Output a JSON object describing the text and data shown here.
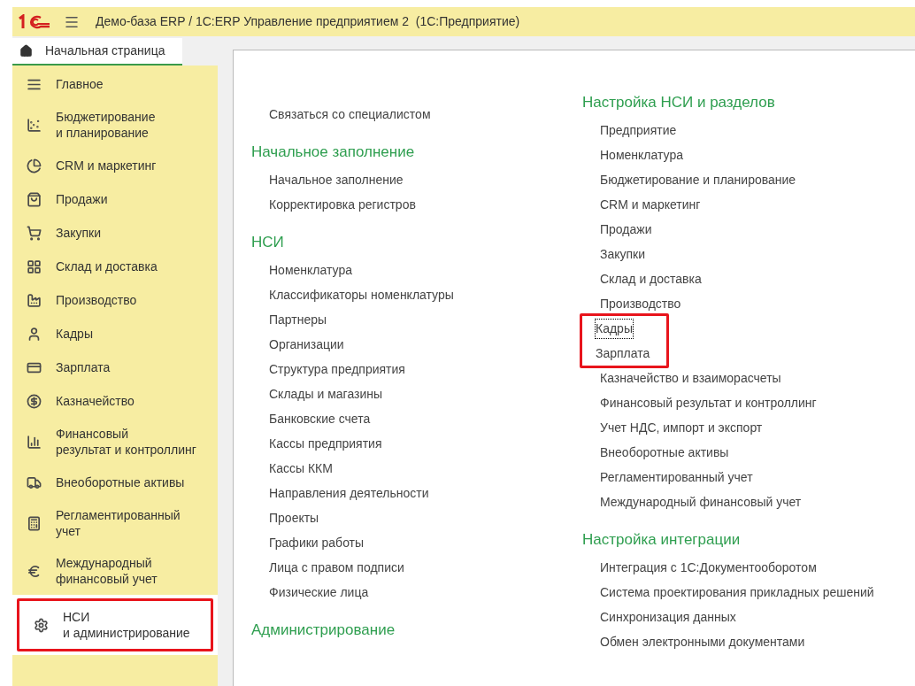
{
  "window": {
    "title": "Демо-база ERP / 1С:ERP Управление предприятием 2  (1С:Предприятие)"
  },
  "tab": {
    "label": "Начальная страница",
    "selected": true
  },
  "sidebar": {
    "items": [
      {
        "label": "Главное",
        "selected": false,
        "highlighted": false
      },
      {
        "label": "Бюджетирование\nи планирование",
        "selected": false,
        "highlighted": false
      },
      {
        "label": "CRM и маркетинг",
        "selected": false,
        "highlighted": false
      },
      {
        "label": "Продажи",
        "selected": false,
        "highlighted": false
      },
      {
        "label": "Закупки",
        "selected": false,
        "highlighted": false
      },
      {
        "label": "Склад и доставка",
        "selected": false,
        "highlighted": false
      },
      {
        "label": "Производство",
        "selected": false,
        "highlighted": false
      },
      {
        "label": "Кадры",
        "selected": false,
        "highlighted": false
      },
      {
        "label": "Зарплата",
        "selected": false,
        "highlighted": false
      },
      {
        "label": "Казначейство",
        "selected": false,
        "highlighted": false
      },
      {
        "label": "Финансовый\nрезультат и контроллинг",
        "selected": false,
        "highlighted": false
      },
      {
        "label": "Внеоборотные активы",
        "selected": false,
        "highlighted": false
      },
      {
        "label": "Регламентированный\nучет",
        "selected": false,
        "highlighted": false
      },
      {
        "label": "Международный\nфинансовый учет",
        "selected": false,
        "highlighted": false
      },
      {
        "label": "НСИ\nи администрирование",
        "selected": true,
        "highlighted": true
      }
    ]
  },
  "columns": [
    [
      {
        "items": [
          {
            "label": "Связаться со специалистом",
            "highlighted": false,
            "focused": false
          }
        ]
      },
      {
        "title": "Начальное заполнение",
        "items": [
          {
            "label": "Начальное заполнение",
            "highlighted": false,
            "focused": false
          },
          {
            "label": "Корректировка регистров",
            "highlighted": false,
            "focused": false
          }
        ]
      },
      {
        "title": "НСИ",
        "items": [
          {
            "label": "Номенклатура",
            "highlighted": false,
            "focused": false
          },
          {
            "label": "Классификаторы номенклатуры",
            "highlighted": false,
            "focused": false
          },
          {
            "label": "Партнеры",
            "highlighted": false,
            "focused": false
          },
          {
            "label": "Организации",
            "highlighted": false,
            "focused": false
          },
          {
            "label": "Структура предприятия",
            "highlighted": false,
            "focused": false
          },
          {
            "label": "Склады и магазины",
            "highlighted": false,
            "focused": false
          },
          {
            "label": "Банковские счета",
            "highlighted": false,
            "focused": false
          },
          {
            "label": "Кассы предприятия",
            "highlighted": false,
            "focused": false
          },
          {
            "label": "Кассы ККМ",
            "highlighted": false,
            "focused": false
          },
          {
            "label": "Направления деятельности",
            "highlighted": false,
            "focused": false
          },
          {
            "label": "Проекты",
            "highlighted": false,
            "focused": false
          },
          {
            "label": "Графики работы",
            "highlighted": false,
            "focused": false
          },
          {
            "label": "Лица с правом подписи",
            "highlighted": false,
            "focused": false
          },
          {
            "label": "Физические лица",
            "highlighted": false,
            "focused": false
          }
        ]
      },
      {
        "title": "Администрирование"
      }
    ],
    [
      {
        "title": "Настройка НСИ и разделов",
        "items": [
          {
            "label": "Предприятие",
            "highlighted": false,
            "focused": false
          },
          {
            "label": "Номенклатура",
            "highlighted": false,
            "focused": false
          },
          {
            "label": "Бюджетирование и планирование",
            "highlighted": false,
            "focused": false
          },
          {
            "label": "CRM и маркетинг",
            "highlighted": false,
            "focused": false
          },
          {
            "label": "Продажи",
            "highlighted": false,
            "focused": false
          },
          {
            "label": "Закупки",
            "highlighted": false,
            "focused": false
          },
          {
            "label": "Склад и доставка",
            "highlighted": false,
            "focused": false
          },
          {
            "label": "Производство",
            "highlighted": false,
            "focused": false
          },
          {
            "label": "Кадры",
            "highlighted": true,
            "focused": true
          },
          {
            "label": "Зарплата",
            "highlighted": true,
            "focused": false
          },
          {
            "label": "Казначейство и взаиморасчеты",
            "highlighted": false,
            "focused": false
          },
          {
            "label": "Финансовый результат и контроллинг",
            "highlighted": false,
            "focused": false
          },
          {
            "label": "Учет НДС, импорт и экспорт",
            "highlighted": false,
            "focused": false
          },
          {
            "label": "Внеоборотные активы",
            "highlighted": false,
            "focused": false
          },
          {
            "label": "Регламентированный учет",
            "highlighted": false,
            "focused": false
          },
          {
            "label": "Международный финансовый учет",
            "highlighted": false,
            "focused": false
          }
        ]
      },
      {
        "title": "Настройка интеграции",
        "items": [
          {
            "label": "Интеграция с 1С:Документооборотом",
            "highlighted": false,
            "focused": false
          },
          {
            "label": "Система проектирования прикладных решений",
            "highlighted": false,
            "focused": false
          },
          {
            "label": "Синхронизация данных",
            "highlighted": false,
            "focused": false
          },
          {
            "label": "Обмен электронными документами",
            "highlighted": false,
            "focused": false
          }
        ]
      }
    ]
  ]
}
